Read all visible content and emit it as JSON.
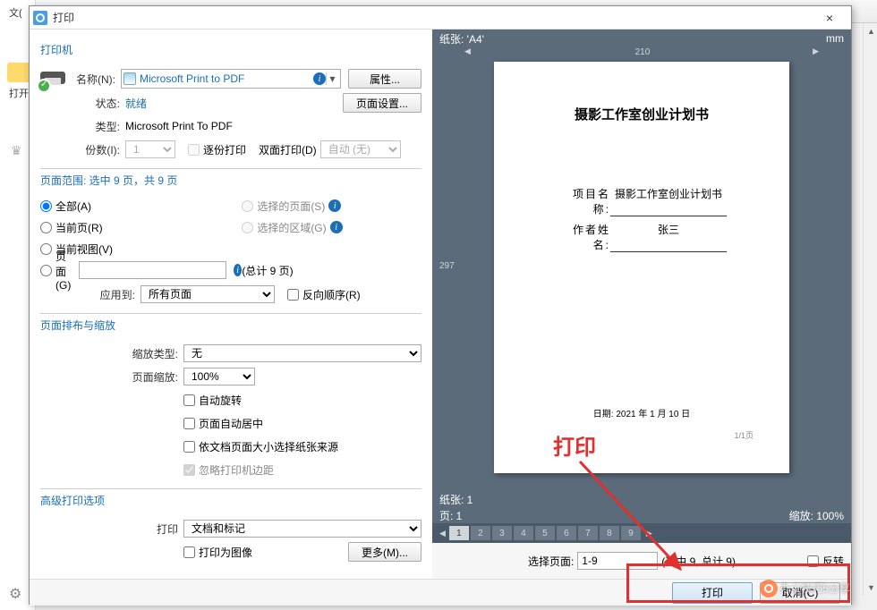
{
  "bg": {
    "open_label": "打开",
    "file_menu": "文("
  },
  "window": {
    "title": "打印",
    "close": "×"
  },
  "printer": {
    "section": "打印机",
    "name_label": "名称(N):",
    "name_value": "Microsoft Print to PDF",
    "properties_btn": "属性...",
    "status_label": "状态:",
    "status_value": "就绪",
    "page_setup_btn": "页面设置...",
    "type_label": "类型:",
    "type_value": "Microsoft Print To PDF",
    "copies_label": "份数(I):",
    "copies_value": "1",
    "collate": "逐份打印",
    "duplex_label": "双面打印(D)",
    "duplex_value": "自动 (无)"
  },
  "range": {
    "section": "页面范围: 选中 9 页，共 9 页",
    "all": "全部(A)",
    "current": "当前页(R)",
    "current_view": "当前视图(V)",
    "pages": "页面(G)",
    "selected_pages": "选择的页面(S)",
    "selected_area": "选择的区域(G)",
    "total": "(总计 9 页)",
    "apply_label": "应用到:",
    "apply_value": "所有页面",
    "reverse": "反向顺序(R)"
  },
  "layout": {
    "section": "页面排布与缩放",
    "scale_type_label": "缩放类型:",
    "scale_type_value": "无",
    "scale_label": "页面缩放:",
    "scale_value": "100%",
    "auto_rotate": "自动旋转",
    "auto_center": "页面自动居中",
    "paper_by_doc": "依文档页面大小选择纸张来源",
    "ignore_margins": "忽略打印机边距"
  },
  "advanced": {
    "section": "高级打印选项",
    "print_label": "打印",
    "print_value": "文档和标记",
    "as_image": "打印为图像",
    "more_btn": "更多(M)..."
  },
  "preview": {
    "paper_label": "纸张: 'A4'",
    "unit": "mm",
    "ruler_w": "210",
    "ruler_h": "297",
    "doc_title": "摄影工作室创业计划书",
    "meta_name_lbl": "项目名称:",
    "meta_name_val": "摄影工作室创业计划书",
    "meta_author_lbl": "作者姓名:",
    "meta_author_val": "张三",
    "date": "日期: 2021 年 1 月 10 日",
    "pgnum": "1/1页",
    "footer_paper": "纸张: 1",
    "footer_page": "页: 1",
    "footer_zoom": "缩放: 100%",
    "pages": [
      "1",
      "2",
      "3",
      "4",
      "5",
      "6",
      "7",
      "8",
      "9"
    ]
  },
  "bottom": {
    "select_label": "选择页面:",
    "select_value": "1-9",
    "select_info": "(选中 9, 总计 9)",
    "reverse": "反转"
  },
  "actions": {
    "print": "打印",
    "cancel": "取消(C)"
  },
  "annotation": "打印",
  "watermark": "办公技巧5分享"
}
